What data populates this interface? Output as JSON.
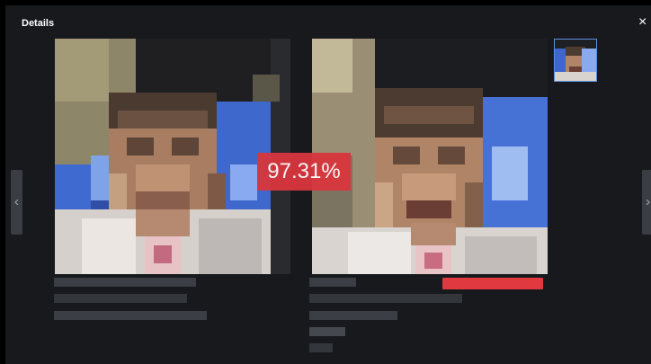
{
  "dialog": {
    "title": "Details",
    "close_symbol": "×"
  },
  "match": {
    "similarity": "97.31%"
  },
  "colors": {
    "background": "#17191d",
    "score_badge": "#d9363e",
    "thumbnail_border": "#5b8fe0",
    "nav_button": "#3a3d43"
  },
  "icons": {
    "prev": "chevron-left-icon",
    "next": "chevron-right-icon",
    "close": "close-icon"
  }
}
